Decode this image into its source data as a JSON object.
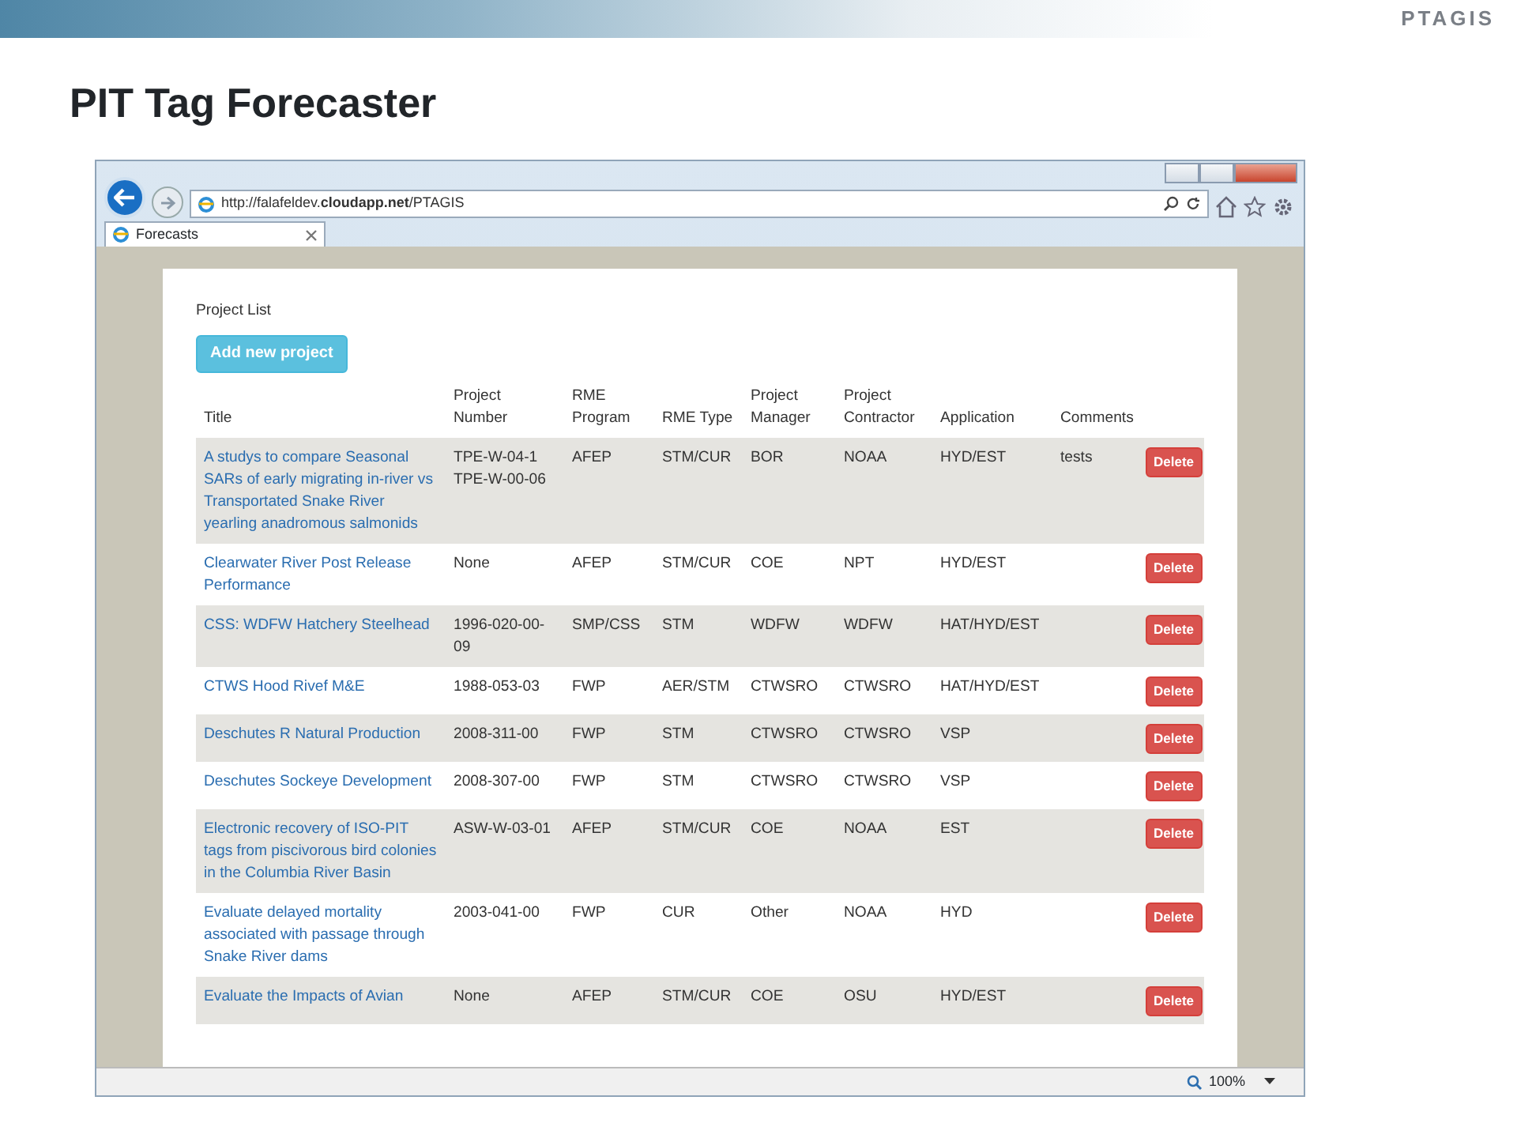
{
  "slide": {
    "title": "PIT Tag Forecaster",
    "logo": "PTAGIS"
  },
  "browser": {
    "url": "http://falafeldev.**cloudapp.net**/PTAGIS",
    "tab": {
      "title": "Forecasts"
    },
    "zoom": "100%"
  },
  "page": {
    "heading": "Project List",
    "add_button": "Add new project",
    "table": {
      "columns": [
        "Title",
        "Project Number",
        "RME Program",
        "RME Type",
        "Project Manager",
        "Project Contractor",
        "Application",
        "Comments"
      ],
      "rows": [
        {
          "title": "A studys to compare Seasonal SARs of early migrating in-river vs Transportated Snake River yearling anadromous salmonids",
          "project_number": "TPE-W-04-1 TPE-W-00-06",
          "rme_program": "AFEP",
          "rme_type": "STM/CUR",
          "project_manager": "BOR",
          "project_contractor": "NOAA",
          "application": "HYD/EST",
          "comments": "tests",
          "action": "Delete"
        },
        {
          "title": "Clearwater River Post Release Performance",
          "project_number": "None",
          "rme_program": "AFEP",
          "rme_type": "STM/CUR",
          "project_manager": "COE",
          "project_contractor": "NPT",
          "application": "HYD/EST",
          "action": "Delete"
        },
        {
          "title": "CSS: WDFW Hatchery Steelhead",
          "project_number": "1996-020-00-09",
          "rme_program": "SMP/CSS",
          "rme_type": "STM",
          "project_manager": "WDFW",
          "project_contractor": "WDFW",
          "application": "HAT/HYD/EST",
          "action": "Delete"
        },
        {
          "title": "CTWS Hood Rivef M&E",
          "project_number": "1988-053-03",
          "rme_program": "FWP",
          "rme_type": "AER/STM",
          "project_manager": "CTWSRO",
          "project_contractor": "CTWSRO",
          "application": "HAT/HYD/EST",
          "action": "Delete"
        },
        {
          "title": "Deschutes R Natural Production",
          "project_number": "2008-311-00",
          "rme_program": "FWP",
          "rme_type": "STM",
          "project_manager": "CTWSRO",
          "project_contractor": "CTWSRO",
          "application": "VSP",
          "action": "Delete"
        },
        {
          "title": "Deschutes Sockeye Development",
          "project_number": "2008-307-00",
          "rme_program": "FWP",
          "rme_type": "STM",
          "project_manager": "CTWSRO",
          "project_contractor": "CTWSRO",
          "application": "VSP",
          "action": "Delete"
        },
        {
          "title": "Electronic recovery of ISO-PIT tags from piscivorous bird colonies in the Columbia River Basin",
          "project_number": "ASW-W-03-01",
          "rme_program": "AFEP",
          "rme_type": "STM/CUR",
          "project_manager": "COE",
          "project_contractor": "NOAA",
          "application": "EST",
          "action": "Delete"
        },
        {
          "title": "Evaluate delayed mortality associated with passage through Snake River dams",
          "project_number": "2003-041-00",
          "rme_program": "FWP",
          "rme_type": "CUR",
          "project_manager": "Other",
          "project_contractor": "NOAA",
          "application": "HYD",
          "action": "Delete"
        },
        {
          "title": "Evaluate the Impacts of Avian",
          "project_number": "None",
          "rme_program": "AFEP",
          "rme_type": "STM/CUR",
          "project_manager": "COE",
          "project_contractor": "OSU",
          "application": "HYD/EST",
          "action": "Delete"
        }
      ]
    }
  }
}
